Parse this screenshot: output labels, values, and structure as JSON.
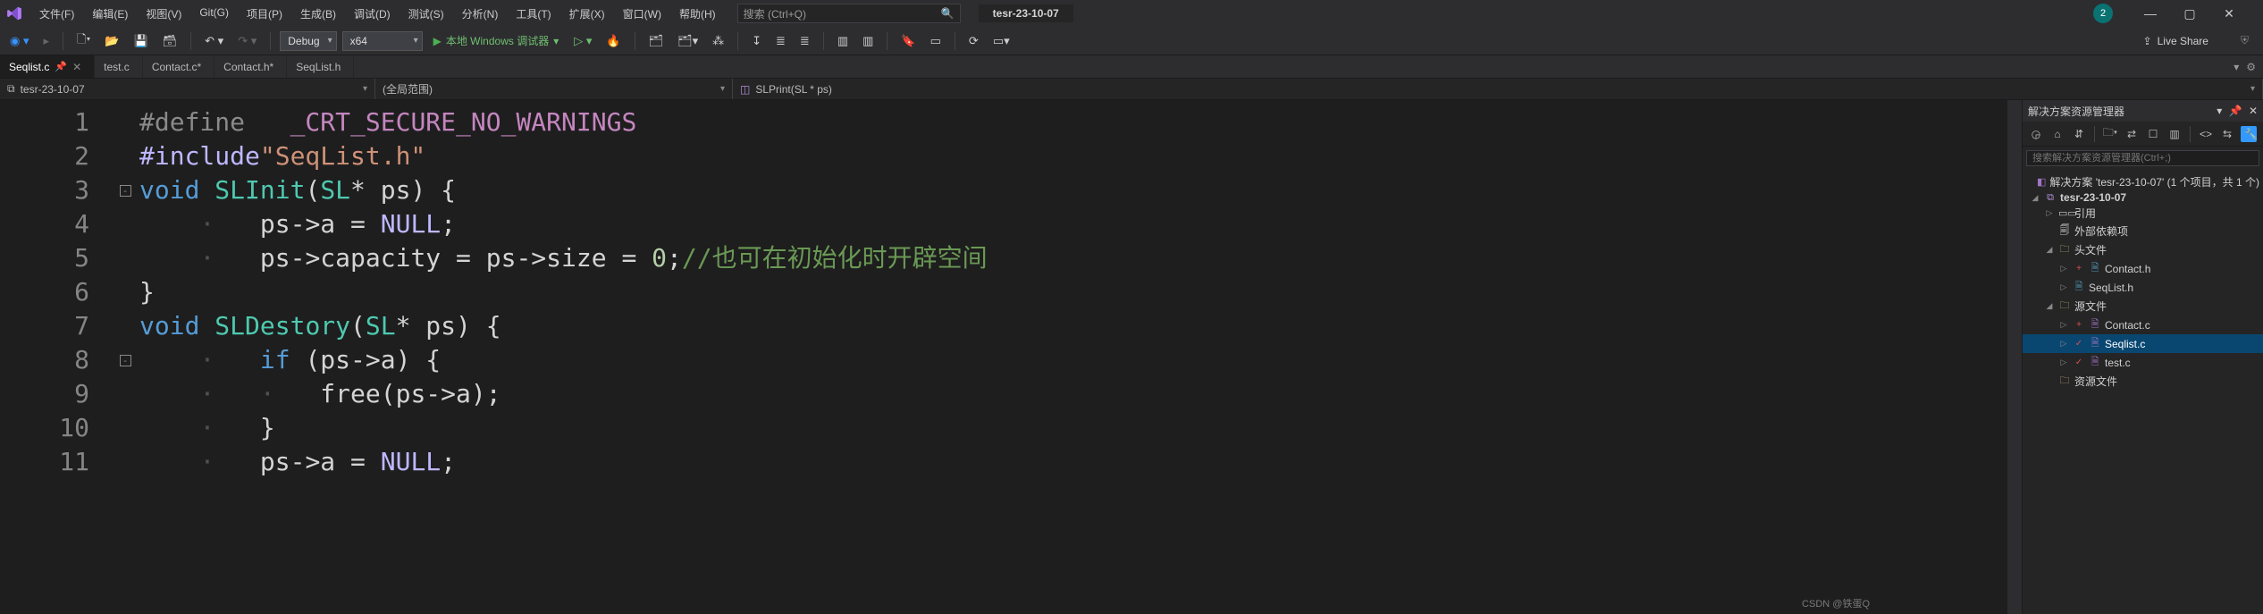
{
  "menu": {
    "items": [
      "文件(F)",
      "编辑(E)",
      "视图(V)",
      "Git(G)",
      "项目(P)",
      "生成(B)",
      "调试(D)",
      "测试(S)",
      "分析(N)",
      "工具(T)",
      "扩展(X)",
      "窗口(W)",
      "帮助(H)"
    ]
  },
  "title_search_placeholder": "搜索 (Ctrl+Q)",
  "title_project": "tesr-23-10-07",
  "notification_badge": "2",
  "toolbar": {
    "config": "Debug",
    "platform": "x64",
    "run_label": "本地 Windows 调试器",
    "live_share": "Live Share"
  },
  "doc_tabs": [
    {
      "label": "Seqlist.c",
      "active": true,
      "pinned": true,
      "closeable": true,
      "dirty": false
    },
    {
      "label": "test.c",
      "active": false,
      "pinned": false,
      "closeable": false,
      "dirty": false
    },
    {
      "label": "Contact.c*",
      "active": false,
      "pinned": false,
      "closeable": false,
      "dirty": true
    },
    {
      "label": "Contact.h*",
      "active": false,
      "pinned": false,
      "closeable": false,
      "dirty": true
    },
    {
      "label": "SeqList.h",
      "active": false,
      "pinned": false,
      "closeable": false,
      "dirty": false
    }
  ],
  "nav": {
    "project": "tesr-23-10-07",
    "scope": "(全局范围)",
    "symbol": "SLPrint(SL * ps)"
  },
  "editor": {
    "line_numbers": [
      "1",
      "2",
      "3",
      "4",
      "5",
      "6",
      "7",
      "8",
      "9",
      "10",
      "11"
    ],
    "code_tokens": [
      [
        [
          "c-def",
          "#define   "
        ],
        [
          "c-upper",
          "_CRT_SECURE_NO_WARNINGS"
        ]
      ],
      [
        [
          "c-mac",
          "#include"
        ],
        [
          "c-str",
          "\"SeqList.h\""
        ]
      ],
      [
        [
          "c-kw",
          "void"
        ],
        [
          "",
          " "
        ],
        [
          "c-type",
          "SLInit"
        ],
        [
          "",
          "("
        ],
        [
          "c-type",
          "SL"
        ],
        [
          "",
          "* ps) {"
        ]
      ],
      [
        [
          "",
          "    "
        ],
        [
          "c-dim",
          "·"
        ],
        [
          "",
          "   ps->a = "
        ],
        [
          "c-null",
          "NULL"
        ],
        [
          "",
          ";"
        ]
      ],
      [
        [
          "",
          "    "
        ],
        [
          "c-dim",
          "·"
        ],
        [
          "",
          "   ps->capacity = ps->size = "
        ],
        [
          "c-num",
          "0"
        ],
        [
          "",
          ";"
        ],
        [
          "c-comment",
          "//也可在初始化时开辟空间"
        ]
      ],
      [
        [
          "",
          "}"
        ]
      ],
      [
        [
          "c-kw",
          "void"
        ],
        [
          "",
          " "
        ],
        [
          "c-type",
          "SLDestory"
        ],
        [
          "",
          "("
        ],
        [
          "c-type",
          "SL"
        ],
        [
          "",
          "* ps) {"
        ]
      ],
      [
        [
          "",
          "    "
        ],
        [
          "c-dim",
          "·"
        ],
        [
          "",
          "   "
        ],
        [
          "c-kw",
          "if"
        ],
        [
          "",
          " (ps->a) {"
        ]
      ],
      [
        [
          "",
          "    "
        ],
        [
          "c-dim",
          "·"
        ],
        [
          "",
          "   "
        ],
        [
          "c-dim",
          "·"
        ],
        [
          "",
          "   free(ps->a);"
        ]
      ],
      [
        [
          "",
          "    "
        ],
        [
          "c-dim",
          "·"
        ],
        [
          "",
          "   }"
        ]
      ],
      [
        [
          "",
          "    "
        ],
        [
          "c-dim",
          "·"
        ],
        [
          "",
          "   ps->a = "
        ],
        [
          "c-null",
          "NULL"
        ],
        [
          "",
          ";"
        ]
      ]
    ],
    "fold_rows": {
      "3": "-",
      "8": "-"
    }
  },
  "solution": {
    "panel_title": "解决方案资源管理器",
    "search_placeholder": "搜索解决方案资源管理器(Ctrl+;)",
    "tree": [
      {
        "depth": 0,
        "tw": "",
        "icon": "sln",
        "glyph": "◧",
        "label": "解决方案 'tesr-23-10-07' (1 个项目，共 1 个)"
      },
      {
        "depth": 0,
        "tw": "◢",
        "icon": "proj",
        "glyph": "⧉",
        "label": "tesr-23-10-07",
        "bold": true
      },
      {
        "depth": 1,
        "tw": "▷",
        "icon": "",
        "glyph": "▭▭",
        "label": "引用"
      },
      {
        "depth": 1,
        "tw": "",
        "icon": "",
        "glyph": "🗐",
        "label": "外部依赖项"
      },
      {
        "depth": 1,
        "tw": "◢",
        "icon": "fold",
        "glyph": "🗀",
        "label": "头文件"
      },
      {
        "depth": 2,
        "tw": "▷",
        "icon": "hfile",
        "glyph": "🗎",
        "label": "Contact.h",
        "pre": "+"
      },
      {
        "depth": 2,
        "tw": "▷",
        "icon": "hfile",
        "glyph": "🗎",
        "label": "SeqList.h"
      },
      {
        "depth": 1,
        "tw": "◢",
        "icon": "fold",
        "glyph": "🗀",
        "label": "源文件"
      },
      {
        "depth": 2,
        "tw": "▷",
        "icon": "cfile",
        "glyph": "🗎",
        "label": "Contact.c",
        "pre": "+"
      },
      {
        "depth": 2,
        "tw": "▷",
        "icon": "cfile",
        "glyph": "🗎",
        "label": "Seqlist.c",
        "pre": "✓",
        "selected": true
      },
      {
        "depth": 2,
        "tw": "▷",
        "icon": "cfile",
        "glyph": "🗎",
        "label": "test.c",
        "pre": "✓"
      },
      {
        "depth": 1,
        "tw": "",
        "icon": "fold",
        "glyph": "🗀",
        "label": "资源文件"
      }
    ]
  },
  "watermark": "CSDN @铁蛋Q"
}
